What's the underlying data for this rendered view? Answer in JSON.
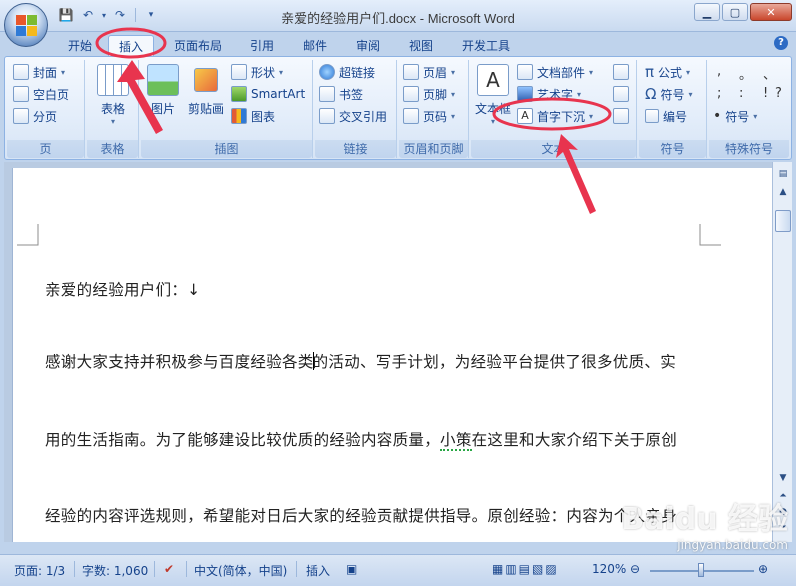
{
  "window": {
    "title": "亲爱的经验用户们.docx - Microsoft Word",
    "controls": [
      "minimize-icon",
      "maximize-icon",
      "close-icon"
    ]
  },
  "qat": {
    "icons": [
      "save-icon",
      "undo-icon",
      "redo-icon",
      "customize-qat-icon"
    ]
  },
  "tabs": [
    "开始",
    "插入",
    "页面布局",
    "引用",
    "邮件",
    "审阅",
    "视图",
    "开发工具"
  ],
  "active_tab": "插入",
  "ribbon": {
    "groups": {
      "pages": {
        "label": "页",
        "items": [
          "封面",
          "空白页",
          "分页"
        ]
      },
      "tables": {
        "label": "表格",
        "items": [
          "表格"
        ]
      },
      "illustrations": {
        "label": "插图",
        "items": [
          "图片",
          "剪贴画",
          "形状",
          "SmartArt",
          "图表"
        ]
      },
      "links": {
        "label": "链接",
        "items": [
          "超链接",
          "书签",
          "交叉引用"
        ]
      },
      "header_footer": {
        "label": "页眉和页脚",
        "items": [
          "页眉",
          "页脚",
          "页码"
        ]
      },
      "text": {
        "label": "文本",
        "items": [
          "文本框",
          "文档部件",
          "艺术字",
          "首字下沉"
        ]
      },
      "symbols": {
        "label": "符号",
        "items": [
          "公式",
          "符号",
          "编号"
        ]
      },
      "special": {
        "label": "特殊符号",
        "items": [
          ",",
          "。",
          "、",
          ";",
          ":",
          "!",
          "?",
          "符号"
        ]
      }
    }
  },
  "document": {
    "paragraphs": [
      "亲爱的经验用户们：↓",
      "感谢大家支持并积极参与百度经验各类的活动、写手计划，为经验平台提供了很多优质、实",
      "用的生活指南。为了能够建设比较优质的经验内容质量，小策在这里和大家介绍下关于原创",
      "经验的内容评选规则，希望能对日后大家的经验贡献提供指导。原创经验：内容为个人亲身"
    ],
    "line1_before_cursor": "感谢大家支持并积极参与百度经验各类",
    "line1_after_cursor": "的活动、写手计划，为经验平台提供了很多优质、实",
    "line2_before_squiggle": "用的生活指南。为了能够建设比较优质的经验内容质量，",
    "line2_squiggle": "小策",
    "line2_after_squiggle": "在这里和大家介绍下关于原创"
  },
  "statusbar": {
    "page": "页面: 1/3",
    "words": "字数: 1,060",
    "language": "中文(简体，中国)",
    "mode": "插入",
    "zoom": "120%"
  },
  "annotation_color": "#e8344e",
  "watermark": {
    "logo": "Baidu 经验",
    "url": "jingyan.baidu.com"
  }
}
